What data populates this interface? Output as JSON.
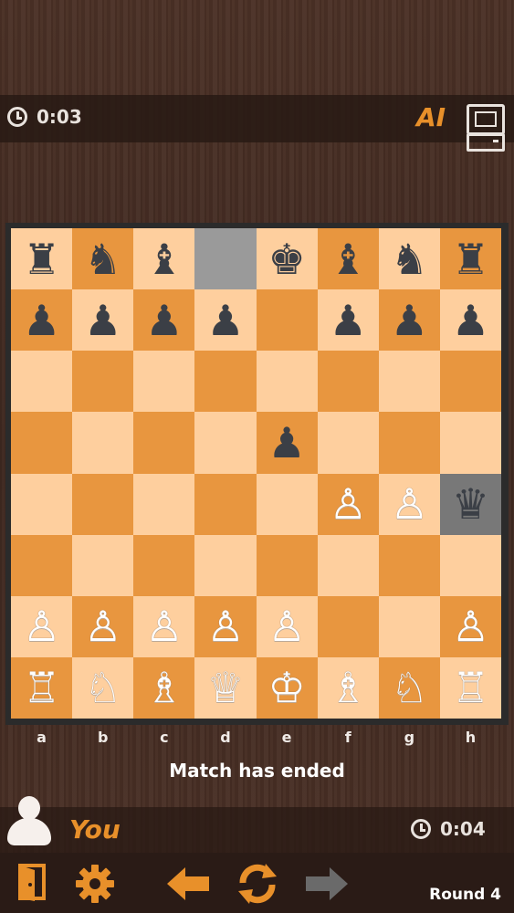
{
  "opponent": {
    "name": "AI",
    "timer": "0:03"
  },
  "player": {
    "name": "You",
    "timer": "0:04"
  },
  "status": "Match has ended",
  "round": "Round 4",
  "files": [
    "a",
    "b",
    "c",
    "d",
    "e",
    "f",
    "g",
    "h"
  ],
  "board": [
    [
      "♜",
      "♞",
      "♝",
      "",
      "♚",
      "♝",
      "♞",
      "♜"
    ],
    [
      "♟",
      "♟",
      "♟",
      "♟",
      "",
      "♟",
      "♟",
      "♟"
    ],
    [
      "",
      "",
      "",
      "",
      "",
      "",
      "",
      ""
    ],
    [
      "",
      "",
      "",
      "",
      "♟",
      "",
      "",
      ""
    ],
    [
      "",
      "",
      "",
      "",
      "",
      "♙",
      "♙",
      "♛"
    ],
    [
      "",
      "",
      "",
      "",
      "",
      "",
      "",
      ""
    ],
    [
      "♙",
      "♙",
      "♙",
      "♙",
      "♙",
      "",
      "",
      "♙"
    ],
    [
      "♖",
      "♘",
      "♗",
      "♕",
      "♔",
      "♗",
      "♘",
      "♖"
    ]
  ],
  "board_colors": {
    "light": "#fecf9e",
    "dark": "#e8963f",
    "highlight": "#9a9a9a"
  },
  "icons": {
    "exit": "door-exit-icon",
    "settings": "gear-icon",
    "undo": "arrow-left-icon",
    "restart": "refresh-icon",
    "redo": "arrow-right-icon"
  }
}
